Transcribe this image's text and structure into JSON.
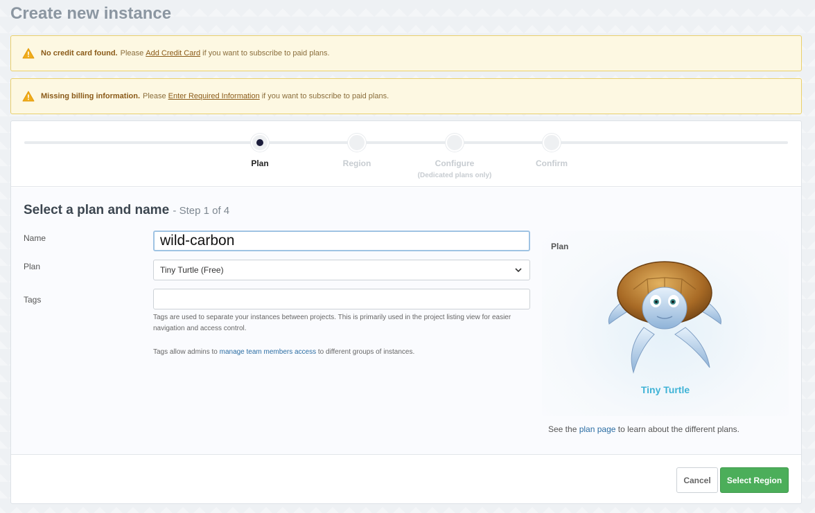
{
  "page": {
    "title": "Create new instance"
  },
  "alerts": [
    {
      "bold": "No credit card found.",
      "before": "Please",
      "link": "Add Credit Card",
      "after": "if you want to subscribe to paid plans."
    },
    {
      "bold": "Missing billing information.",
      "before": "Please",
      "link": "Enter Required Information",
      "after": "if you want to subscribe to paid plans."
    }
  ],
  "stepper": {
    "current": 1,
    "steps": [
      {
        "label": "Plan",
        "sub": ""
      },
      {
        "label": "Region",
        "sub": ""
      },
      {
        "label": "Configure",
        "sub": "(Dedicated plans only)"
      },
      {
        "label": "Confirm",
        "sub": ""
      }
    ]
  },
  "form": {
    "heading": "Select a plan and name",
    "step_note": "- Step 1 of 4",
    "name_label": "Name",
    "name_value": "wild-carbon",
    "plan_label": "Plan",
    "plan_value": "Tiny Turtle (Free)",
    "tags_label": "Tags",
    "tags_value": "",
    "tags_help": "Tags are used to separate your instances between projects. This is primarily used in the project listing view for easier navigation and access control.",
    "admin_help_before": "Tags allow admins to",
    "admin_help_link": "manage team members access",
    "admin_help_after": "to different groups of instances."
  },
  "plan_panel": {
    "label": "Plan",
    "plan_name": "Tiny Turtle",
    "mascot_icon": "turtle-illustration",
    "note_before": "See the",
    "note_link": "plan page",
    "note_after": "to learn about the different plans."
  },
  "actions": {
    "cancel": "Cancel",
    "primary": "Select Region"
  },
  "colors": {
    "primary": "#4cae5a",
    "alert_bg": "#fdf8e2",
    "link": "#2b6da3",
    "plan_accent": "#3fb3d6"
  }
}
